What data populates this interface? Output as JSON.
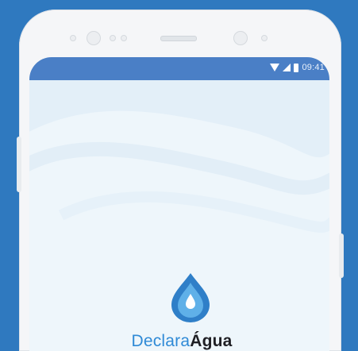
{
  "status_bar": {
    "time": "09:41",
    "icons": [
      "wifi-icon",
      "signal-icon",
      "battery-icon"
    ]
  },
  "brand": {
    "part1": "Declara",
    "part2": "Água",
    "logo": "water-drop-icon"
  },
  "colors": {
    "background": "#2f79bf",
    "status_bar": "#4a7fc6",
    "screen": "#eef6fb",
    "brand_primary": "#2f8ad6",
    "brand_dark": "#1f1f24"
  }
}
